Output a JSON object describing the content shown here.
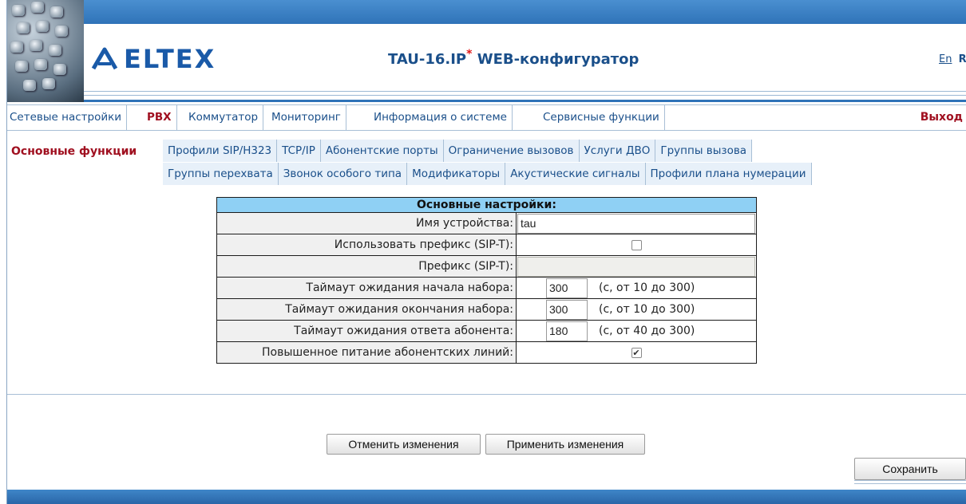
{
  "brand": {
    "logo_text": "ELTEX"
  },
  "header": {
    "title_main": "TAU-16.IP",
    "title_star": "*",
    "title_rest": " WEB-конфигуратор",
    "lang_en": "En",
    "lang_ru": "Ru"
  },
  "mainnav": {
    "items": [
      {
        "label": "Сетевые настройки"
      },
      {
        "label": "PBX"
      },
      {
        "label": "Коммутатор"
      },
      {
        "label": "Мониторинг"
      },
      {
        "label": "Информация о системе"
      },
      {
        "label": "Сервисные функции"
      }
    ],
    "exit_label": "Выход"
  },
  "subnav": {
    "active_label": "Основные функции",
    "row1": [
      {
        "label": "Профили SIP/H323"
      },
      {
        "label": "TCP/IP"
      },
      {
        "label": "Абонентские порты"
      },
      {
        "label": "Ограничение вызовов"
      },
      {
        "label": "Услуги ДВО"
      },
      {
        "label": "Группы вызова"
      }
    ],
    "row2": [
      {
        "label": "Группы перехвата"
      },
      {
        "label": "Звонок особого типа"
      },
      {
        "label": "Модификаторы"
      },
      {
        "label": "Акустические сигналы"
      },
      {
        "label": "Профили плана нумерации"
      }
    ]
  },
  "settings": {
    "heading": "Основные настройки:",
    "device_name_label": "Имя устройства:",
    "device_name_value": "tau",
    "use_prefix_label": "Использовать префикс (SIP-T):",
    "use_prefix_checked": false,
    "prefix_label": "Префикс (SIP-T):",
    "prefix_value": "",
    "dial_start_label": "Таймаут ожидания начала набора:",
    "dial_start_value": "300",
    "dial_start_range": "(с, от 10 до 300)",
    "dial_end_label": "Таймаут ожидания окончания набора:",
    "dial_end_value": "300",
    "dial_end_range": "(с, от 10 до 300)",
    "answer_label": "Таймаут ожидания ответа абонента:",
    "answer_value": "180",
    "answer_range": "(с, от 40 до 300)",
    "power_label": "Повышенное питание абонентских линий:",
    "power_checked": true
  },
  "buttons": {
    "cancel": "Отменить изменения",
    "apply": "Применить изменения",
    "save": "Сохранить"
  },
  "colors": {
    "accent": "#2f73b8",
    "active_nav": "#a01020",
    "table_header": "#8fd0f4",
    "link": "#1a4f8a"
  }
}
